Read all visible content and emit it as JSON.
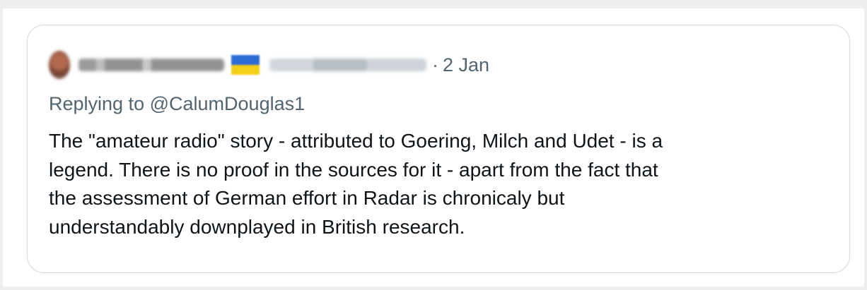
{
  "tweet": {
    "timestamp": "2 Jan",
    "separator": "·",
    "replying_to_label": "Replying to",
    "replying_to_handle": "@CalumDouglas1",
    "text_lines": [
      "The \"amateur radio\" story - attributed to Goering, Milch and Udet - is a",
      "legend. There is no proof in the sources for it - apart from the fact that",
      "the assessment of German effort in Radar is chronicaly but",
      "understandably downplayed in British research."
    ]
  },
  "icons": {
    "avatar": "blurred-avatar",
    "flag": "ukraine-flag-icon"
  },
  "colors": {
    "background": "#efefef",
    "card": "#ffffff",
    "border": "#cfd9de",
    "secondary_text": "#536471",
    "primary_text": "#0f1419",
    "flag_blue": "#2d6bd6",
    "flag_yellow": "#f5cf17"
  }
}
